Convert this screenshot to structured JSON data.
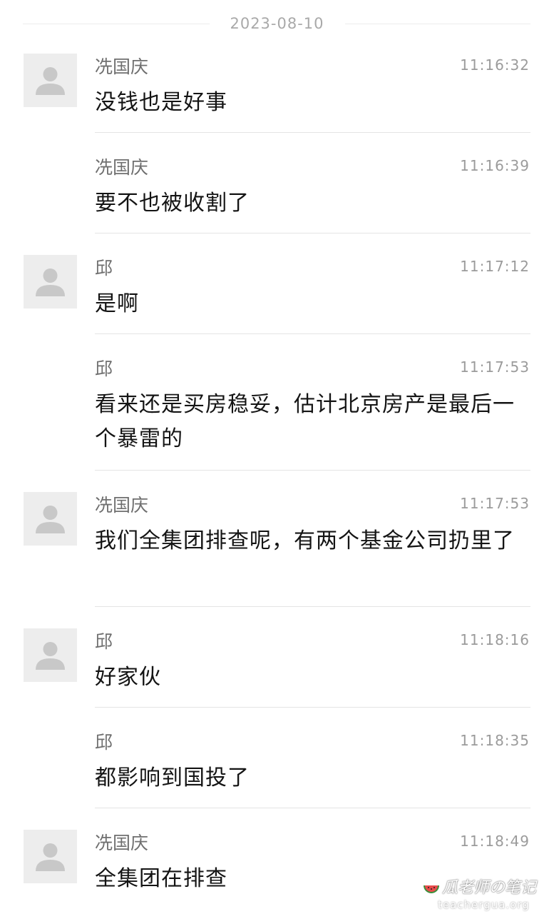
{
  "date_separator": "2023-08-10",
  "messages": [
    {
      "sender": "冼国庆",
      "time": "11:16:32",
      "text": "没钱也是好事",
      "show_avatar": true
    },
    {
      "sender": "冼国庆",
      "time": "11:16:39",
      "text": "要不也被收割了",
      "show_avatar": false
    },
    {
      "sender": "邱",
      "time": "11:17:12",
      "text": "是啊",
      "show_avatar": true
    },
    {
      "sender": "邱",
      "time": "11:17:53",
      "text": "看来还是买房稳妥，估计北京房产是最后一个暴雷的",
      "show_avatar": false
    },
    {
      "sender": "冼国庆",
      "time": "11:17:53",
      "text": "我们全集团排查呢，有两个基金公司扔里了",
      "show_avatar": true
    },
    {
      "sender": "邱",
      "time": "11:18:16",
      "text": "好家伙",
      "show_avatar": true
    },
    {
      "sender": "邱",
      "time": "11:18:35",
      "text": "都影响到国投了",
      "show_avatar": false
    },
    {
      "sender": "冼国庆",
      "time": "11:18:49",
      "text": "全集团在排查",
      "show_avatar": true
    }
  ],
  "watermark": {
    "title": "瓜老师の笔记",
    "url": "teachergua.org"
  },
  "colors": {
    "avatar_bg": "#ededed",
    "avatar_figure": "#c8c8c8",
    "sender": "#6f6f6f",
    "time": "#9b9b9b",
    "text": "#141414",
    "divider": "#e4e4e4"
  }
}
